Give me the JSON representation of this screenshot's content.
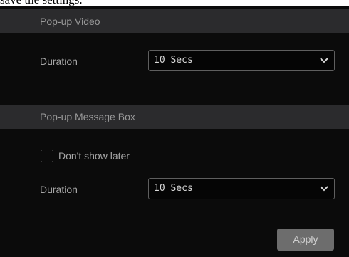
{
  "caption": "save the settings.",
  "popup_video": {
    "header": "Pop-up Video",
    "duration_label": "Duration",
    "duration_value": "10 Secs"
  },
  "popup_message": {
    "header": "Pop-up Message Box",
    "dont_show_label": "Don't show later",
    "dont_show_checked": false,
    "duration_label": "Duration",
    "duration_value": "10 Secs"
  },
  "apply_label": "Apply",
  "icons": {
    "dropdown": "chevron-down-icon"
  }
}
